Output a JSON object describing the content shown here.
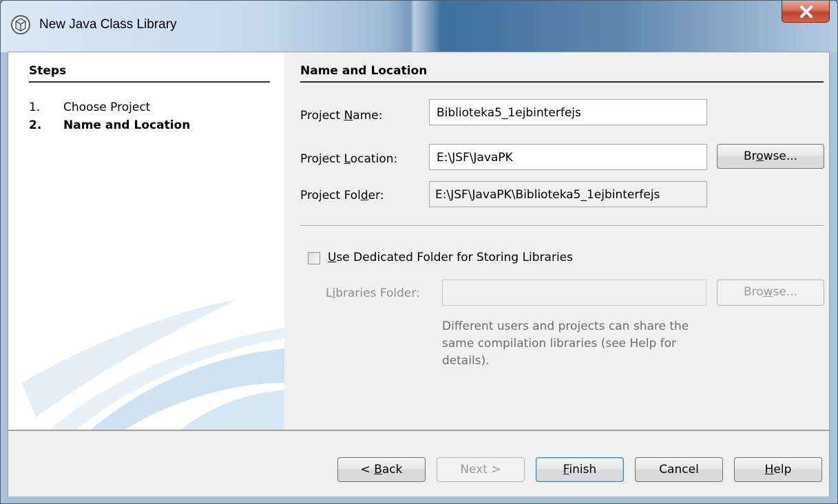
{
  "window": {
    "title": "New Java Class Library"
  },
  "steps": {
    "title": "Steps",
    "items": [
      {
        "number": "1.",
        "label": "Choose Project"
      },
      {
        "number": "2.",
        "label": "Name and Location"
      }
    ]
  },
  "main": {
    "section_title": "Name and Location",
    "project_name": {
      "label_pre": "Project ",
      "label_key": "N",
      "label_post": "ame:",
      "value": "Biblioteka5_1ejbinterfejs"
    },
    "project_location": {
      "label_pre": "Project ",
      "label_key": "L",
      "label_post": "ocation:",
      "value": "E:\\JSF\\JavaPK"
    },
    "project_folder": {
      "label_pre": "Project Fol",
      "label_key": "d",
      "label_post": "er:",
      "value": "E:\\JSF\\JavaPK\\Biblioteka5_1ejbinterfejs"
    },
    "browse_location": {
      "pre": "Br",
      "key": "o",
      "post": "wse..."
    },
    "dedicated_folder": {
      "key": "U",
      "post": "se Dedicated Folder for Storing Libraries",
      "checked": false
    },
    "libraries_folder": {
      "label_pre": "L",
      "label_key": "i",
      "label_post": "braries Folder:",
      "value": ""
    },
    "browse_libraries": {
      "pre": "Bro",
      "key": "w",
      "post": "se..."
    },
    "help_text": "Different users and projects can share the same compilation libraries (see Help for details)."
  },
  "buttons": {
    "back": {
      "pre": "< ",
      "key": "B",
      "post": "ack"
    },
    "next": "Next >",
    "finish": {
      "pre": "",
      "key": "F",
      "post": "inish"
    },
    "cancel": "Cancel",
    "help": {
      "pre": "",
      "key": "H",
      "post": "elp"
    }
  },
  "colors": {
    "title_bar": "#3e6f9e",
    "close_button": "#c3412a",
    "dialog_background": "#f0f0f0",
    "default_button_border": "#3c7fb1"
  }
}
